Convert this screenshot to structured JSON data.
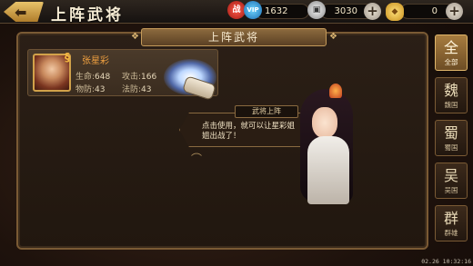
{
  "header": {
    "title": "上阵武将",
    "stat1_icon_text": "战",
    "stat1_value": "1632",
    "coin_value": "3030",
    "gold_value": "0",
    "plus_label": "+"
  },
  "panel": {
    "banner": "上阵武将",
    "general": {
      "name": "张星彩",
      "hp_label": "生命:",
      "hp": "648",
      "atk_label": "攻击:",
      "atk": "166",
      "pdef_label": "物防:",
      "pdef": "43",
      "mdef_label": "法防:",
      "mdef": "43"
    }
  },
  "dialog": {
    "label": "武将上阵",
    "text": "点击使用，就可以让星彩姐姐出战了！"
  },
  "tabs": [
    {
      "big": "全",
      "small": "全部"
    },
    {
      "big": "魏",
      "small": "魏国"
    },
    {
      "big": "蜀",
      "small": "蜀国"
    },
    {
      "big": "吴",
      "small": "吴国"
    },
    {
      "big": "群",
      "small": "群雄"
    }
  ],
  "timestamp": "02.26 10:32:16"
}
